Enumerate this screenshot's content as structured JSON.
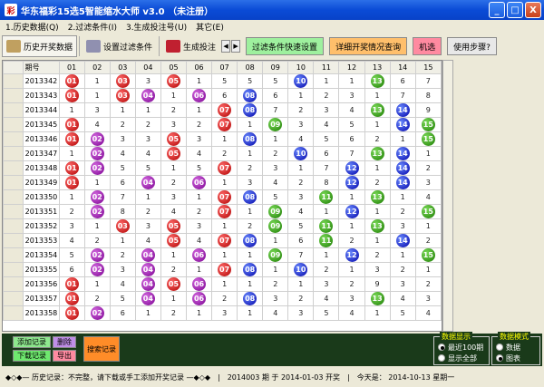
{
  "window": {
    "title": "华东福彩15选5智能缩水大师 v3.0  （未注册）",
    "controls": {
      "minimize": "_",
      "maximize": "□",
      "close": "X"
    }
  },
  "menu": [
    "1.历史数据(Q)",
    "2.过滤条件(I)",
    "3.生成投注号(U)",
    "其它(E)"
  ],
  "toolbar": {
    "tabs": [
      {
        "label": "历史开奖数据",
        "icon": "books-icon",
        "color": "#c0a060"
      },
      {
        "label": "设置过滤条件",
        "icon": "settings-icon",
        "color": "#9090b0"
      },
      {
        "label": "生成投注",
        "icon": "ruby-icon",
        "color": "#c02030"
      }
    ],
    "arrows": [
      "◀",
      "▶"
    ],
    "actions": [
      {
        "label": "过滤条件快速设置",
        "color": "#9ef09e"
      },
      {
        "label": "详细开奖情况查询",
        "color": "#ffbf6b"
      },
      {
        "label": "机选",
        "color": "#ff8aa0"
      },
      {
        "label": "使用步骤?",
        "color": "#e8e8e8"
      }
    ]
  },
  "grid": {
    "header": [
      "期号",
      "01",
      "02",
      "03",
      "04",
      "05",
      "06",
      "07",
      "08",
      "09",
      "10",
      "11",
      "12",
      "13",
      "14",
      "15"
    ],
    "rows": [
      {
        "issue": "2013342",
        "cells": [
          [
            "b",
            "01"
          ],
          [
            "n",
            "1"
          ],
          [
            "b",
            "03"
          ],
          [
            "n",
            "3"
          ],
          [
            "b",
            "05"
          ],
          [
            "n",
            "1"
          ],
          [
            "n",
            "5"
          ],
          [
            "n",
            "5"
          ],
          [
            "n",
            "5"
          ],
          [
            "b",
            "10"
          ],
          [
            "n",
            "1"
          ],
          [
            "n",
            "1"
          ],
          [
            "b",
            "13"
          ],
          [
            "n",
            "6"
          ],
          [
            "n",
            "7"
          ]
        ]
      },
      {
        "issue": "2013343",
        "cells": [
          [
            "b",
            "01"
          ],
          [
            "n",
            "1"
          ],
          [
            "b",
            "03"
          ],
          [
            "b",
            "04"
          ],
          [
            "n",
            "1"
          ],
          [
            "b",
            "06"
          ],
          [
            "n",
            "6"
          ],
          [
            "b",
            "08"
          ],
          [
            "n",
            "6"
          ],
          [
            "n",
            "1"
          ],
          [
            "n",
            "2"
          ],
          [
            "n",
            "3"
          ],
          [
            "n",
            "1"
          ],
          [
            "n",
            "7"
          ],
          [
            "n",
            "8"
          ]
        ]
      },
      {
        "issue": "2013344",
        "cells": [
          [
            "n",
            "1"
          ],
          [
            "n",
            "3"
          ],
          [
            "n",
            "1"
          ],
          [
            "n",
            "1"
          ],
          [
            "n",
            "2"
          ],
          [
            "n",
            "1"
          ],
          [
            "b",
            "07"
          ],
          [
            "b",
            "08"
          ],
          [
            "n",
            "7"
          ],
          [
            "n",
            "2"
          ],
          [
            "n",
            "3"
          ],
          [
            "n",
            "4"
          ],
          [
            "b",
            "13"
          ],
          [
            "b",
            "14"
          ],
          [
            "n",
            "9"
          ]
        ]
      },
      {
        "issue": "2013345",
        "cells": [
          [
            "b",
            "01"
          ],
          [
            "n",
            "4"
          ],
          [
            "n",
            "2"
          ],
          [
            "n",
            "2"
          ],
          [
            "n",
            "3"
          ],
          [
            "n",
            "2"
          ],
          [
            "b",
            "07"
          ],
          [
            "n",
            "1"
          ],
          [
            "b",
            "09"
          ],
          [
            "n",
            "3"
          ],
          [
            "n",
            "4"
          ],
          [
            "n",
            "5"
          ],
          [
            "n",
            "1"
          ],
          [
            "b",
            "14"
          ],
          [
            "b",
            "15"
          ]
        ]
      },
      {
        "issue": "2013346",
        "cells": [
          [
            "b",
            "01"
          ],
          [
            "b",
            "02"
          ],
          [
            "n",
            "3"
          ],
          [
            "n",
            "3"
          ],
          [
            "b",
            "05"
          ],
          [
            "n",
            "3"
          ],
          [
            "n",
            "1"
          ],
          [
            "b",
            "08"
          ],
          [
            "n",
            "1"
          ],
          [
            "n",
            "4"
          ],
          [
            "n",
            "5"
          ],
          [
            "n",
            "6"
          ],
          [
            "n",
            "2"
          ],
          [
            "n",
            "1"
          ],
          [
            "b",
            "15"
          ]
        ]
      },
      {
        "issue": "2013347",
        "cells": [
          [
            "n",
            "1"
          ],
          [
            "b",
            "02"
          ],
          [
            "n",
            "4"
          ],
          [
            "n",
            "4"
          ],
          [
            "b",
            "05"
          ],
          [
            "n",
            "4"
          ],
          [
            "n",
            "2"
          ],
          [
            "n",
            "1"
          ],
          [
            "n",
            "2"
          ],
          [
            "b",
            "10"
          ],
          [
            "n",
            "6"
          ],
          [
            "n",
            "7"
          ],
          [
            "b",
            "13"
          ],
          [
            "b",
            "14"
          ],
          [
            "n",
            "1"
          ]
        ]
      },
      {
        "issue": "2013348",
        "cells": [
          [
            "b",
            "01"
          ],
          [
            "b",
            "02"
          ],
          [
            "n",
            "5"
          ],
          [
            "n",
            "5"
          ],
          [
            "n",
            "1"
          ],
          [
            "n",
            "5"
          ],
          [
            "b",
            "07"
          ],
          [
            "n",
            "2"
          ],
          [
            "n",
            "3"
          ],
          [
            "n",
            "1"
          ],
          [
            "n",
            "7"
          ],
          [
            "b",
            "12"
          ],
          [
            "n",
            "1"
          ],
          [
            "b",
            "14"
          ],
          [
            "n",
            "2"
          ]
        ]
      },
      {
        "issue": "2013349",
        "cells": [
          [
            "b",
            "01"
          ],
          [
            "n",
            "1"
          ],
          [
            "n",
            "6"
          ],
          [
            "b",
            "04"
          ],
          [
            "n",
            "2"
          ],
          [
            "b",
            "06"
          ],
          [
            "n",
            "1"
          ],
          [
            "n",
            "3"
          ],
          [
            "n",
            "4"
          ],
          [
            "n",
            "2"
          ],
          [
            "n",
            "8"
          ],
          [
            "b",
            "12"
          ],
          [
            "n",
            "2"
          ],
          [
            "b",
            "14"
          ],
          [
            "n",
            "3"
          ]
        ]
      },
      {
        "issue": "2013350",
        "cells": [
          [
            "n",
            "1"
          ],
          [
            "b",
            "02"
          ],
          [
            "n",
            "7"
          ],
          [
            "n",
            "1"
          ],
          [
            "n",
            "3"
          ],
          [
            "n",
            "1"
          ],
          [
            "b",
            "07"
          ],
          [
            "b",
            "08"
          ],
          [
            "n",
            "5"
          ],
          [
            "n",
            "3"
          ],
          [
            "b",
            "11"
          ],
          [
            "n",
            "1"
          ],
          [
            "b",
            "13"
          ],
          [
            "n",
            "1"
          ],
          [
            "n",
            "4"
          ]
        ]
      },
      {
        "issue": "2013351",
        "cells": [
          [
            "n",
            "2"
          ],
          [
            "b",
            "02"
          ],
          [
            "n",
            "8"
          ],
          [
            "n",
            "2"
          ],
          [
            "n",
            "4"
          ],
          [
            "n",
            "2"
          ],
          [
            "b",
            "07"
          ],
          [
            "n",
            "1"
          ],
          [
            "b",
            "09"
          ],
          [
            "n",
            "4"
          ],
          [
            "n",
            "1"
          ],
          [
            "b",
            "12"
          ],
          [
            "n",
            "1"
          ],
          [
            "n",
            "2"
          ],
          [
            "b",
            "15"
          ]
        ]
      },
      {
        "issue": "2013352",
        "cells": [
          [
            "n",
            "3"
          ],
          [
            "n",
            "1"
          ],
          [
            "b",
            "03"
          ],
          [
            "n",
            "3"
          ],
          [
            "b",
            "05"
          ],
          [
            "n",
            "3"
          ],
          [
            "n",
            "1"
          ],
          [
            "n",
            "2"
          ],
          [
            "b",
            "09"
          ],
          [
            "n",
            "5"
          ],
          [
            "b",
            "11"
          ],
          [
            "n",
            "1"
          ],
          [
            "b",
            "13"
          ],
          [
            "n",
            "3"
          ],
          [
            "n",
            "1"
          ]
        ]
      },
      {
        "issue": "2013353",
        "cells": [
          [
            "n",
            "4"
          ],
          [
            "n",
            "2"
          ],
          [
            "n",
            "1"
          ],
          [
            "n",
            "4"
          ],
          [
            "b",
            "05"
          ],
          [
            "n",
            "4"
          ],
          [
            "b",
            "07"
          ],
          [
            "b",
            "08"
          ],
          [
            "n",
            "1"
          ],
          [
            "n",
            "6"
          ],
          [
            "b",
            "11"
          ],
          [
            "n",
            "2"
          ],
          [
            "n",
            "1"
          ],
          [
            "b",
            "14"
          ],
          [
            "n",
            "2"
          ]
        ]
      },
      {
        "issue": "2013354",
        "cells": [
          [
            "n",
            "5"
          ],
          [
            "b",
            "02"
          ],
          [
            "n",
            "2"
          ],
          [
            "b",
            "04"
          ],
          [
            "n",
            "1"
          ],
          [
            "b",
            "06"
          ],
          [
            "n",
            "1"
          ],
          [
            "n",
            "1"
          ],
          [
            "b",
            "09"
          ],
          [
            "n",
            "7"
          ],
          [
            "n",
            "1"
          ],
          [
            "b",
            "12"
          ],
          [
            "n",
            "2"
          ],
          [
            "n",
            "1"
          ],
          [
            "b",
            "15"
          ]
        ]
      },
      {
        "issue": "2013355",
        "cells": [
          [
            "n",
            "6"
          ],
          [
            "b",
            "02"
          ],
          [
            "n",
            "3"
          ],
          [
            "b",
            "04"
          ],
          [
            "n",
            "2"
          ],
          [
            "n",
            "1"
          ],
          [
            "b",
            "07"
          ],
          [
            "b",
            "08"
          ],
          [
            "n",
            "1"
          ],
          [
            "b",
            "10"
          ],
          [
            "n",
            "2"
          ],
          [
            "n",
            "1"
          ],
          [
            "n",
            "3"
          ],
          [
            "n",
            "2"
          ],
          [
            "n",
            "1"
          ]
        ]
      },
      {
        "issue": "2013356",
        "cells": [
          [
            "b",
            "01"
          ],
          [
            "n",
            "1"
          ],
          [
            "n",
            "4"
          ],
          [
            "b",
            "04"
          ],
          [
            "b",
            "05"
          ],
          [
            "b",
            "06"
          ],
          [
            "n",
            "1"
          ],
          [
            "n",
            "1"
          ],
          [
            "n",
            "2"
          ],
          [
            "n",
            "1"
          ],
          [
            "n",
            "3"
          ],
          [
            "n",
            "2"
          ],
          [
            "n",
            "9"
          ],
          [
            "n",
            "3"
          ],
          [
            "n",
            "2"
          ]
        ]
      },
      {
        "issue": "2013357",
        "cells": [
          [
            "b",
            "01"
          ],
          [
            "n",
            "2"
          ],
          [
            "n",
            "5"
          ],
          [
            "b",
            "04"
          ],
          [
            "n",
            "1"
          ],
          [
            "b",
            "06"
          ],
          [
            "n",
            "2"
          ],
          [
            "b",
            "08"
          ],
          [
            "n",
            "3"
          ],
          [
            "n",
            "2"
          ],
          [
            "n",
            "4"
          ],
          [
            "n",
            "3"
          ],
          [
            "b",
            "13"
          ],
          [
            "n",
            "4"
          ],
          [
            "n",
            "3"
          ]
        ]
      },
      {
        "issue": "2013358",
        "cells": [
          [
            "b",
            "01"
          ],
          [
            "b",
            "02"
          ],
          [
            "n",
            "6"
          ],
          [
            "n",
            "1"
          ],
          [
            "n",
            "2"
          ],
          [
            "n",
            "1"
          ],
          [
            "n",
            "3"
          ],
          [
            "n",
            "1"
          ],
          [
            "n",
            "4"
          ],
          [
            "n",
            "3"
          ],
          [
            "n",
            "5"
          ],
          [
            "n",
            "4"
          ],
          [
            "n",
            "1"
          ],
          [
            "n",
            "5"
          ],
          [
            "n",
            "4"
          ]
        ]
      }
    ]
  },
  "ball_colors": {
    "red": "#c00000",
    "purple": "#8a00a0",
    "blue": "#0000b0",
    "green": "#208a00"
  },
  "bottom": {
    "buttons": [
      {
        "label": "添加记录",
        "color": "#8ee88e"
      },
      {
        "label": "删除",
        "color": "#c08ee8"
      },
      {
        "label": "下载记录",
        "color": "#6ee86e"
      },
      {
        "label": "导出",
        "color": "#ff8aa0"
      }
    ],
    "search": "搜索记录",
    "display_group": {
      "legend": "数据显示",
      "options": [
        "最近100期",
        "显示全部"
      ],
      "selected": "最近100期"
    },
    "mode_group": {
      "legend": "数据模式",
      "options": [
        "数据",
        "图表"
      ],
      "selected": "图表"
    }
  },
  "status": {
    "history": "◆◇◆— 历史记录：不完整，请下载或手工添加开奖记录 —◆◇◆",
    "issue": "2014003 期 于 2014-01-03 开奖",
    "today": "今天是： 2014-10-13 星期一"
  }
}
